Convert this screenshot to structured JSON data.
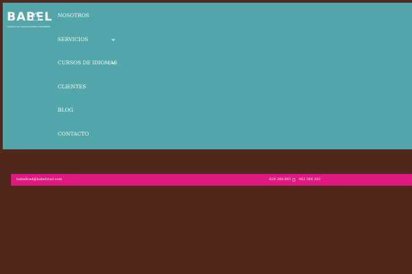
{
  "header": {
    "logo_text": "BABEL",
    "logo_tagline": "AGENCIA DE TRADUCCIONES E INTÉRPRETES",
    "background_color": "#52a6a9"
  },
  "nav": {
    "items": [
      {
        "label": "NOSOTROS",
        "has_dropdown": false
      },
      {
        "label": "SERVICIOS",
        "has_dropdown": true
      },
      {
        "label": "CURSOS DE IDIOMAS",
        "has_dropdown": true
      },
      {
        "label": "CLIENTES",
        "has_dropdown": false
      },
      {
        "label": "BLOG",
        "has_dropdown": false
      },
      {
        "label": "CONTACTO",
        "has_dropdown": false
      }
    ]
  },
  "contact_bar": {
    "email": "babeltrad@babeltrad.com",
    "phone_mobile": "629 260 801",
    "phone_landline": "942 364 362",
    "background_color": "#e0187f"
  },
  "page": {
    "background_color": "#51291c"
  },
  "icons": {
    "dropdown": "chevron-down-icon",
    "phone": "phone-icon"
  }
}
